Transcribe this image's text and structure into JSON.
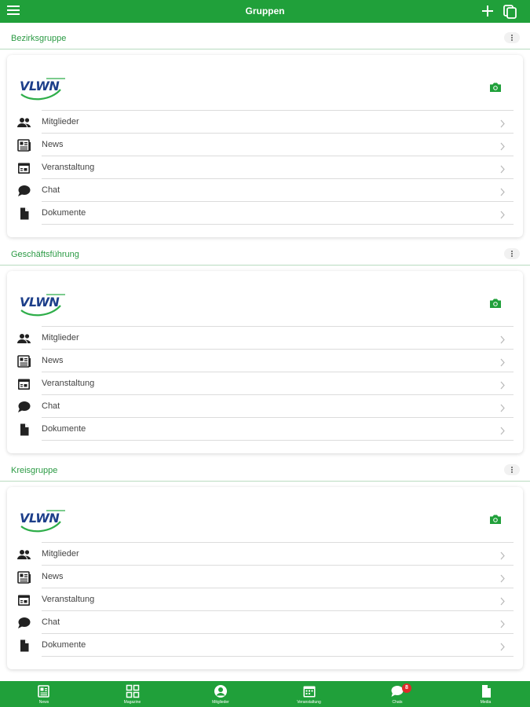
{
  "header": {
    "title": "Gruppen"
  },
  "colors": {
    "brand_green": "#20a03a",
    "section_green": "#2b9a44",
    "badge_red": "#e02a2a",
    "logo_blue": "#1d3f8a"
  },
  "groups": [
    {
      "name": "Bezirksgruppe",
      "logo_text": "VLWN",
      "items": [
        {
          "label": "Mitglieder",
          "icon": "people-icon"
        },
        {
          "label": "News",
          "icon": "newspaper-icon"
        },
        {
          "label": "Veranstaltung",
          "icon": "calendar-icon"
        },
        {
          "label": "Chat",
          "icon": "chat-icon"
        },
        {
          "label": "Dokumente",
          "icon": "document-icon"
        }
      ]
    },
    {
      "name": "Geschäftsführung",
      "logo_text": "VLWN",
      "items": [
        {
          "label": "Mitglieder",
          "icon": "people-icon"
        },
        {
          "label": "News",
          "icon": "newspaper-icon"
        },
        {
          "label": "Veranstaltung",
          "icon": "calendar-icon"
        },
        {
          "label": "Chat",
          "icon": "chat-icon"
        },
        {
          "label": "Dokumente",
          "icon": "document-icon"
        }
      ]
    },
    {
      "name": "Kreisgruppe",
      "logo_text": "VLWN",
      "items": [
        {
          "label": "Mitglieder",
          "icon": "people-icon"
        },
        {
          "label": "News",
          "icon": "newspaper-icon"
        },
        {
          "label": "Veranstaltung",
          "icon": "calendar-icon"
        },
        {
          "label": "Chat",
          "icon": "chat-icon"
        },
        {
          "label": "Dokumente",
          "icon": "document-icon"
        }
      ]
    }
  ],
  "bottom_nav": [
    {
      "label": "News",
      "icon": "newspaper-icon"
    },
    {
      "label": "Magazine",
      "icon": "grid-icon"
    },
    {
      "label": "Mitglieder",
      "icon": "person-icon"
    },
    {
      "label": "Veranstaltung",
      "icon": "calendar-icon"
    },
    {
      "label": "Chats",
      "icon": "chat-icon",
      "badge": "8"
    },
    {
      "label": "Media",
      "icon": "document-icon"
    }
  ]
}
